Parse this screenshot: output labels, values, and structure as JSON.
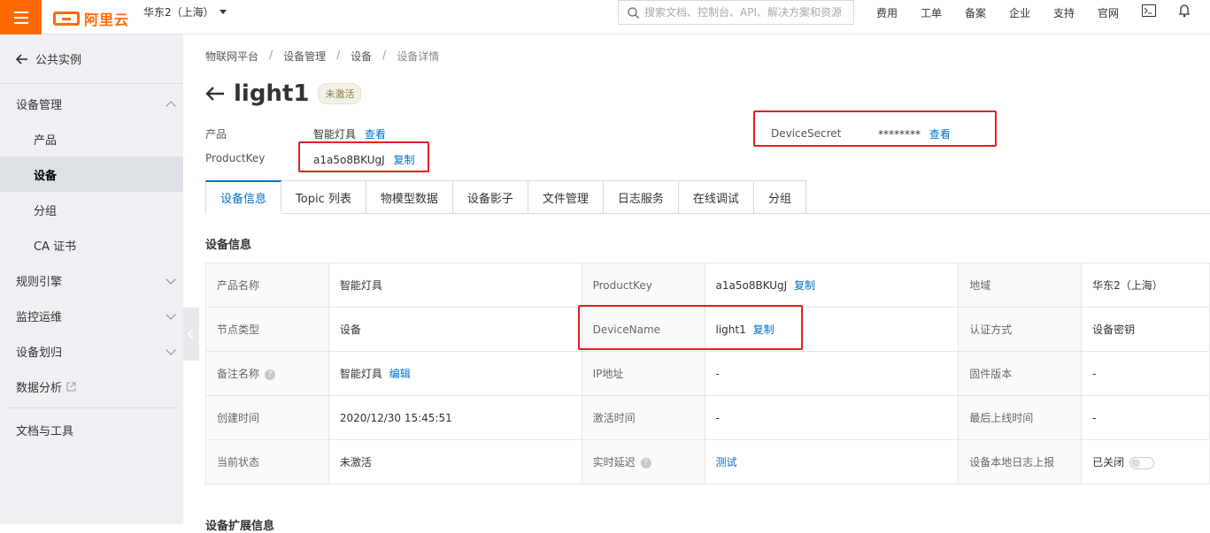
{
  "topbar": {
    "logo_text": "阿里云",
    "region": "华东2（上海）",
    "search_placeholder": "搜索文档、控制台、API、解决方案和资源",
    "links": [
      "费用",
      "工单",
      "备案",
      "企业",
      "支持",
      "官网"
    ],
    "accent": "#ff6a00"
  },
  "sidebar": {
    "back_label": "公共实例",
    "items": [
      {
        "label": "设备管理"
      },
      {
        "label": "产品"
      },
      {
        "label": "设备"
      },
      {
        "label": "分组"
      },
      {
        "label": "CA 证书"
      },
      {
        "label": "规则引擎"
      },
      {
        "label": "监控运维"
      },
      {
        "label": "设备划归"
      },
      {
        "label": "数据分析"
      },
      {
        "label": "文档与工具"
      }
    ]
  },
  "breadcrumb": [
    "物联网平台",
    "设备管理",
    "设备",
    "设备详情"
  ],
  "breadcrumb_sep": "/",
  "device": {
    "name": "light1",
    "status": "未激活",
    "product_label": "产品",
    "product_value": "智能灯具",
    "view_label": "查看",
    "productkey_label": "ProductKey",
    "productkey_value": "a1a5o8BKUgJ",
    "copy_label": "复制",
    "secret_label": "DeviceSecret",
    "secret_value": "********",
    "secret_view_label": "查看"
  },
  "tabs": [
    "设备信息",
    "Topic 列表",
    "物模型数据",
    "设备影子",
    "文件管理",
    "日志服务",
    "在线调试",
    "分组"
  ],
  "section_title": "设备信息",
  "info_rows": [
    {
      "k1": "产品名称",
      "v1": "智能灯具",
      "k2": "ProductKey",
      "v2": "a1a5o8BKUgJ",
      "v2_link": "复制",
      "k3": "地域",
      "v3": "华东2（上海）"
    },
    {
      "k1": "节点类型",
      "v1": "设备",
      "k2": "DeviceName",
      "v2": "light1",
      "v2_link": "复制",
      "k3": "认证方式",
      "v3": "设备密钥"
    },
    {
      "k1": "备注名称",
      "v1": "智能灯具",
      "v1_link": "编辑",
      "k2": "IP地址",
      "v2": "-",
      "k3": "固件版本",
      "v3": "-"
    },
    {
      "k1": "创建时间",
      "v1": "2020/12/30 15:45:51",
      "k2": "激活时间",
      "v2": "-",
      "k3": "最后上线时间",
      "v3": "-"
    },
    {
      "k1": "当前状态",
      "v1": "未激活",
      "k2": "实时延迟",
      "v2": "测试",
      "k3": "设备本地日志上报",
      "v3": "已关闭"
    }
  ],
  "next_section_title": "设备扩展信息",
  "colors": {
    "link": "#0070cc",
    "highlight_box": "#e02020"
  }
}
